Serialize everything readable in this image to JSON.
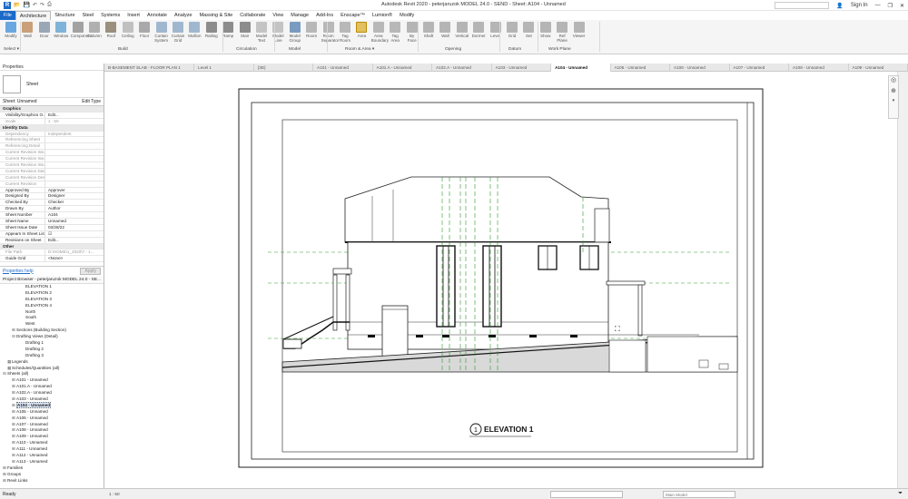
{
  "titlebar": {
    "title": "Autodesk Revit 2020 - peterjaruzok MODEL 24.0 - SEND - Sheet: A104 - Unnamed",
    "search_placeholder": "Type a keyword or phrase",
    "sign_in": "Sign In"
  },
  "menu": [
    "File",
    "Architecture",
    "Structure",
    "Steel",
    "Systems",
    "Insert",
    "Annotate",
    "Analyze",
    "Massing & Site",
    "Collaborate",
    "View",
    "Manage",
    "Add-Ins",
    "Enscape™",
    "Lumion®",
    "Modify"
  ],
  "ribbon": {
    "buttons": [
      "Modify",
      "Wall",
      "Door",
      "Window",
      "Component",
      "Column",
      "Roof",
      "Ceiling",
      "Floor",
      "Curtain System",
      "Curtain Grid",
      "Mullion",
      "Railing",
      "Ramp",
      "Stair",
      "Model Text",
      "Model Line",
      "Model Group",
      "Room",
      "Room Separator",
      "Tag Room",
      "Area",
      "Area Boundary",
      "Tag Area",
      "By Face",
      "Shaft",
      "Wall",
      "Vertical",
      "Dormer",
      "Level",
      "Grid",
      "Set",
      "Show",
      "Ref Plane",
      "Viewer"
    ],
    "groups": [
      "Select ▾",
      "Build",
      "Circulation",
      "Model",
      "Room & Area ▾",
      "Opening",
      "Datum",
      "Work Plane"
    ]
  },
  "properties": {
    "header": "Properties",
    "type_name": "Sheet",
    "selector": "Sheet: Unnamed",
    "edit_type": "Edit Type",
    "rows": [
      {
        "k": "Graphics",
        "v": "",
        "section": true
      },
      {
        "k": "Visibility/Graphics O...",
        "v": "Edit..."
      },
      {
        "k": "Scale",
        "v": "1 : 50",
        "grey": true
      },
      {
        "k": "Identity Data",
        "v": "",
        "section": true
      },
      {
        "k": "Dependency",
        "v": "Independent",
        "grey": true
      },
      {
        "k": "Referencing Sheet",
        "v": "",
        "grey": true
      },
      {
        "k": "Referencing Detail",
        "v": "",
        "grey": true
      },
      {
        "k": "Current Revision Issu...",
        "v": "",
        "grey": true
      },
      {
        "k": "Current Revision Issu...",
        "v": "",
        "grey": true
      },
      {
        "k": "Current Revision Issu...",
        "v": "",
        "grey": true
      },
      {
        "k": "Current Revision Date",
        "v": "",
        "grey": true
      },
      {
        "k": "Current Revision Desc...",
        "v": "",
        "grey": true
      },
      {
        "k": "Current Revision",
        "v": "",
        "grey": true
      },
      {
        "k": "Approved By",
        "v": "Approver"
      },
      {
        "k": "Designed By",
        "v": "Designer"
      },
      {
        "k": "Checked By",
        "v": "Checker"
      },
      {
        "k": "Drawn By",
        "v": "Author"
      },
      {
        "k": "Sheet Number",
        "v": "A104"
      },
      {
        "k": "Sheet Name",
        "v": "Unnamed"
      },
      {
        "k": "Sheet Issue Date",
        "v": "03/28/22"
      },
      {
        "k": "Appears In Sheet List",
        "v": "☑"
      },
      {
        "k": "Revisions on Sheet",
        "v": "Edit..."
      },
      {
        "k": "Other",
        "v": "",
        "section": true
      },
      {
        "k": "File Path",
        "v": "D:\\HOME\\1_2020\\7 - 1...",
        "grey": true
      },
      {
        "k": "Guide Grid",
        "v": "<None>"
      }
    ],
    "help_link": "Properties help",
    "apply": "Apply"
  },
  "browser": {
    "header": "Project Browser - peterjaruzok MODEL 24.0 - SE...",
    "items": [
      {
        "label": "ELEVATION 1",
        "indent": 4
      },
      {
        "label": "ELEVATION 2",
        "indent": 4
      },
      {
        "label": "ELEVATION 3",
        "indent": 4
      },
      {
        "label": "ELEVATION 4",
        "indent": 4
      },
      {
        "label": "North",
        "indent": 4
      },
      {
        "label": "South",
        "indent": 4
      },
      {
        "label": "West",
        "indent": 4
      },
      {
        "label": "Sections (Building Section)",
        "indent": 2,
        "exp": "⊞"
      },
      {
        "label": "Drafting Views (Detail)",
        "indent": 2,
        "exp": "⊟"
      },
      {
        "label": "Drafting 1",
        "indent": 4
      },
      {
        "label": "Drafting 2",
        "indent": 4
      },
      {
        "label": "Drafting 3",
        "indent": 4
      },
      {
        "label": "Legends",
        "indent": 1,
        "exp": "▦"
      },
      {
        "label": "Schedules/Quantities (all)",
        "indent": 1,
        "exp": "▦"
      },
      {
        "label": "Sheets (all)",
        "indent": 0,
        "exp": "⊟"
      },
      {
        "label": "A101 - Unnamed",
        "indent": 2,
        "exp": "⊞"
      },
      {
        "label": "A101.A - Unnamed",
        "indent": 2,
        "exp": "⊞"
      },
      {
        "label": "A102.A - Unnamed",
        "indent": 2,
        "exp": "⊞"
      },
      {
        "label": "A103 - Unnamed",
        "indent": 2,
        "exp": "⊞"
      },
      {
        "label": "A104 - Unnamed",
        "indent": 2,
        "exp": "⊞",
        "selected": true
      },
      {
        "label": "A105 - Unnamed",
        "indent": 2,
        "exp": "⊞"
      },
      {
        "label": "A106 - Unnamed",
        "indent": 2,
        "exp": "⊞"
      },
      {
        "label": "A107 - Unnamed",
        "indent": 2,
        "exp": "⊞"
      },
      {
        "label": "A108 - Unnamed",
        "indent": 2,
        "exp": "⊞"
      },
      {
        "label": "A109 - Unnamed",
        "indent": 2,
        "exp": "⊞"
      },
      {
        "label": "A110 - Unnamed",
        "indent": 2,
        "exp": "⊞"
      },
      {
        "label": "A111 - Unnamed",
        "indent": 2,
        "exp": "⊞"
      },
      {
        "label": "A112 - Unnamed",
        "indent": 2,
        "exp": "⊞"
      },
      {
        "label": "A113 - Unnamed",
        "indent": 2,
        "exp": "⊞"
      },
      {
        "label": "Families",
        "indent": 0,
        "exp": "⊞"
      },
      {
        "label": "Groups",
        "indent": 0,
        "exp": "⊞"
      },
      {
        "label": "Revit Links",
        "indent": 0,
        "exp": "⊞"
      }
    ]
  },
  "tabs": [
    {
      "label": "B-BASEMENT SLAB - FLOOR PLAN 1"
    },
    {
      "label": "Level 1"
    },
    {
      "label": "{3D}"
    },
    {
      "label": "A101 - Unnamed"
    },
    {
      "label": "A101.A - Unnamed"
    },
    {
      "label": "A102.A - Unnamed"
    },
    {
      "label": "A103 - Unnamed"
    },
    {
      "label": "A104 - Unnamed",
      "active": true
    },
    {
      "label": "A105 - Unnamed"
    },
    {
      "label": "A106 - Unnamed"
    },
    {
      "label": "A107 - Unnamed"
    },
    {
      "label": "A108 - Unnamed"
    },
    {
      "label": "A109 - Unnamed"
    }
  ],
  "sheet": {
    "view_number": "1",
    "view_title": "ELEVATION 1"
  },
  "statusbar": {
    "ready": "Ready",
    "model": "Main Model",
    "scale": "1 : 50"
  }
}
